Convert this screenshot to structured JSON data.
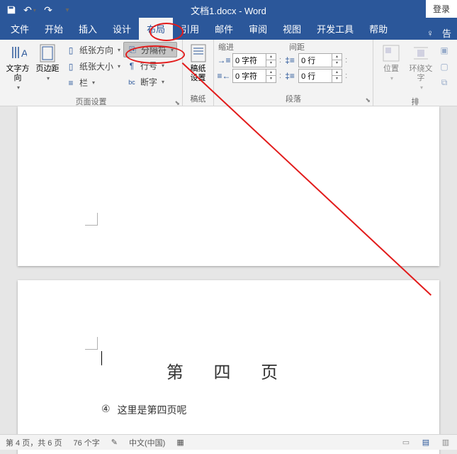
{
  "titlebar": {
    "title": "文档1.docx - Word",
    "login": "登录"
  },
  "tabs": {
    "file": "文件",
    "home": "开始",
    "insert": "插入",
    "design": "设计",
    "layout": "布局",
    "references": "引用",
    "mailings": "邮件",
    "review": "审阅",
    "view": "视图",
    "developer": "开发工具",
    "help": "帮助",
    "tell": "告"
  },
  "ribbon": {
    "text_direction": "文字方向",
    "margins": "页边距",
    "orientation": "纸张方向",
    "size": "纸张大小",
    "columns": "栏",
    "breaks": "分隔符",
    "line_numbers": "行号",
    "hyphenation": "断字",
    "page_setup_group": "页面设置",
    "manuscript": "稿纸\n设置",
    "manuscript_group": "稿纸",
    "indent_label": "缩进",
    "spacing_label": "间距",
    "indent_left_value": "0 字符",
    "indent_right_value": "0 字符",
    "spacing_before": "0 行",
    "spacing_after": "0 行",
    "paragraph_group": "段落",
    "position": "位置",
    "wrap_text": "环绕文字",
    "arrange_group": "排"
  },
  "document": {
    "page_heading": "第 四 页",
    "line_number": "④",
    "line_text": "这里是第四页呢"
  },
  "statusbar": {
    "page_info": "第 4 页，共 6 页",
    "word_count": "76 个字",
    "language": "中文(中国)"
  }
}
